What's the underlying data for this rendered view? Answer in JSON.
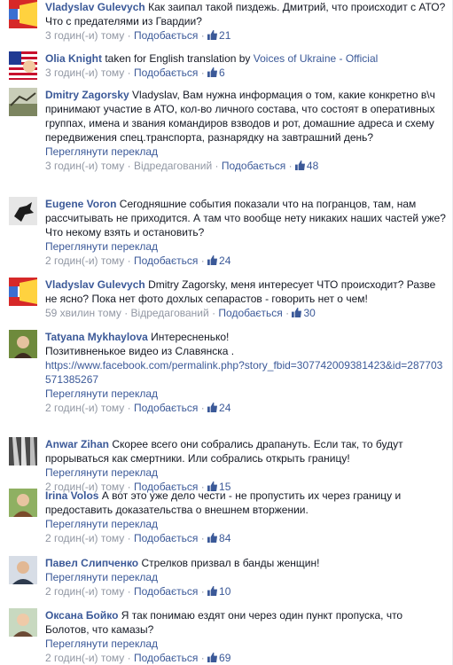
{
  "comments": [
    {
      "author": "Vladyslav Gulevych",
      "text": "Как заипал такой пиздежь. Дмитрий, что происходит с АТО? Что с предателями из Гвардии?",
      "translate": null,
      "time": "3 годин(-и) тому",
      "edited": null,
      "like": "Подобається",
      "likes": "21"
    },
    {
      "author": "Olia Knight",
      "text_pre": "taken for English translation by ",
      "text_link": "Voices of Ukraine - Official",
      "translate": null,
      "time": "3 годин(-и) тому",
      "edited": null,
      "like": "Подобається",
      "likes": "6"
    },
    {
      "author": "Dmitry Zagorsky",
      "text": "Vladyslav, Вам нужна информация о том, какие конкретно в\\ч принимают участие в АТО, кол-во личного состава, что состоят в оперативных группах, имена и звания командиров взводов и рот, домашние адреса и схему передвижения спец.транспорта, разнарядку на завтрашний день?",
      "translate": "Переглянути переклад",
      "time": "3 годин(-и) тому",
      "edited": "Відредагований",
      "like": "Подобається",
      "likes": "48"
    },
    {
      "author": "Eugene Voron",
      "text": "Сегодняшние события показали что на погранцов, там, нам рассчитывать не приходится. А там что вообще нету никаких наших частей уже? Что некому взять и остановить?",
      "translate": "Переглянути переклад",
      "time": "2 годин(-и) тому",
      "edited": null,
      "like": "Подобається",
      "likes": "24"
    },
    {
      "author": "Vladyslav Gulevych",
      "text": "Dmitry Zagorsky, меня интересует ЧТО происходит? Разве не ясно? Пока нет фото дохлых сепарастов - говорить нет о чем!",
      "translate": null,
      "time": "59 хвилин тому",
      "edited": "Відредагований",
      "like": "Подобається",
      "likes": "30"
    },
    {
      "author": "Tatyana Mykhaylova",
      "text": "Интересненько!\nПозитивненькое видео из Славянска .\n",
      "text_link": "https://www.facebook.com/permalink.php?story_fbid=307742009381423&id=287703571385267",
      "translate": "Переглянути переклад",
      "time": "2 годин(-и) тому",
      "edited": null,
      "like": "Подобається",
      "likes": "24"
    },
    {
      "author": "Anwar Zihan",
      "text": "Скорее всего они собрались драпануть. Если так, то будут прорываться как смертники. Или собрались открыть границу!",
      "translate": "Переглянути переклад",
      "time": "2 годин(-и) тому",
      "edited": null,
      "like": "Подобається",
      "likes": "15"
    },
    {
      "author": "Irina Volos",
      "text": "А вот это уже дело чести - не пропустить их через границу и предоставить доказательства о внешнем вторжении.",
      "translate": "Переглянути переклад",
      "time": "2 годин(-и) тому",
      "edited": null,
      "like": "Подобається",
      "likes": "84"
    },
    {
      "author": "Павел Слипченко",
      "text": "Стрелков призвал в банды женщин!",
      "translate": "Переглянути переклад",
      "time": "2 годин(-и) тому",
      "edited": null,
      "like": "Подобається",
      "likes": "10"
    },
    {
      "author": "Оксана Бойко",
      "text": "Я так понимаю ездят они через один пункт пропуска, что Болотов, что камазы?",
      "translate": "Переглянути переклад",
      "time": "2 годин(-и) тому",
      "edited": null,
      "like": "Подобається",
      "likes": "69"
    }
  ],
  "avatars": [
    "flag-avatar",
    "us-flag-avatar",
    "landscape-avatar",
    "raven-avatar",
    "flag-avatar",
    "portrait-avatar",
    "light-beams-avatar",
    "portrait-avatar",
    "man-portrait-avatar",
    "woman-portrait-avatar"
  ],
  "colors": {
    "link": "#3b5998",
    "meta": "#9197a3",
    "text": "#141823"
  }
}
